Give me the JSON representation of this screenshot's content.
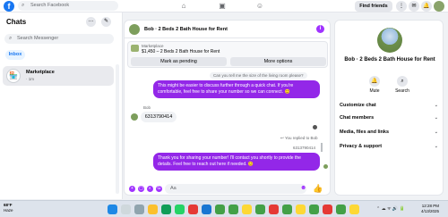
{
  "topbar": {
    "logo": "f",
    "search_placeholder": "Search Facebook",
    "find_friends": "Find friends",
    "nav_icons": [
      "home-icon",
      "store-icon",
      "groups-icon"
    ]
  },
  "left": {
    "title": "Chats",
    "more": "…",
    "compose": "✎",
    "search_placeholder": "Search Messenger",
    "inbox": "Inbox",
    "conversation": {
      "name": "Marketplace",
      "time": "· 1m"
    }
  },
  "conversation": {
    "title": "Bob · 2 Beds 2 Bath House for Rent",
    "info": "i",
    "listing": {
      "label": "Marketplace",
      "description": "$1,450 – 2 Beds 2 Bath House for Rent",
      "mark_pending": "Mark as pending",
      "more_options": "More options"
    },
    "preview": "Can you tell me the size of the living room please?",
    "msg1": "This might be easier to discuss further through a quick chat. If you're comfortable, feel free to share your number so we can connect. 😊",
    "sender": "Bob",
    "incoming": "6313790414",
    "replied_label": "↩ You replied to Bob",
    "replied_quote": "6313790414",
    "msg2": "Thank you for sharing your number! I'll contact you shortly to provide the details. Feel free to reach out here if needed. 😊",
    "composer_placeholder": "Aa",
    "like": "👍"
  },
  "right": {
    "name": "Bob · 2 Beds 2 Bath House for Rent",
    "mute": "Mute",
    "search": "Search",
    "sections": [
      "Customize chat",
      "Chat members",
      "Media, files and links",
      "Privacy & support"
    ]
  },
  "taskbar": {
    "temp": "68°F",
    "weather": "Haze",
    "time": "12:28 PM",
    "date": "4/13/2025"
  },
  "colors": {
    "accent": "#9327e8",
    "fb_blue": "#1877f2"
  }
}
